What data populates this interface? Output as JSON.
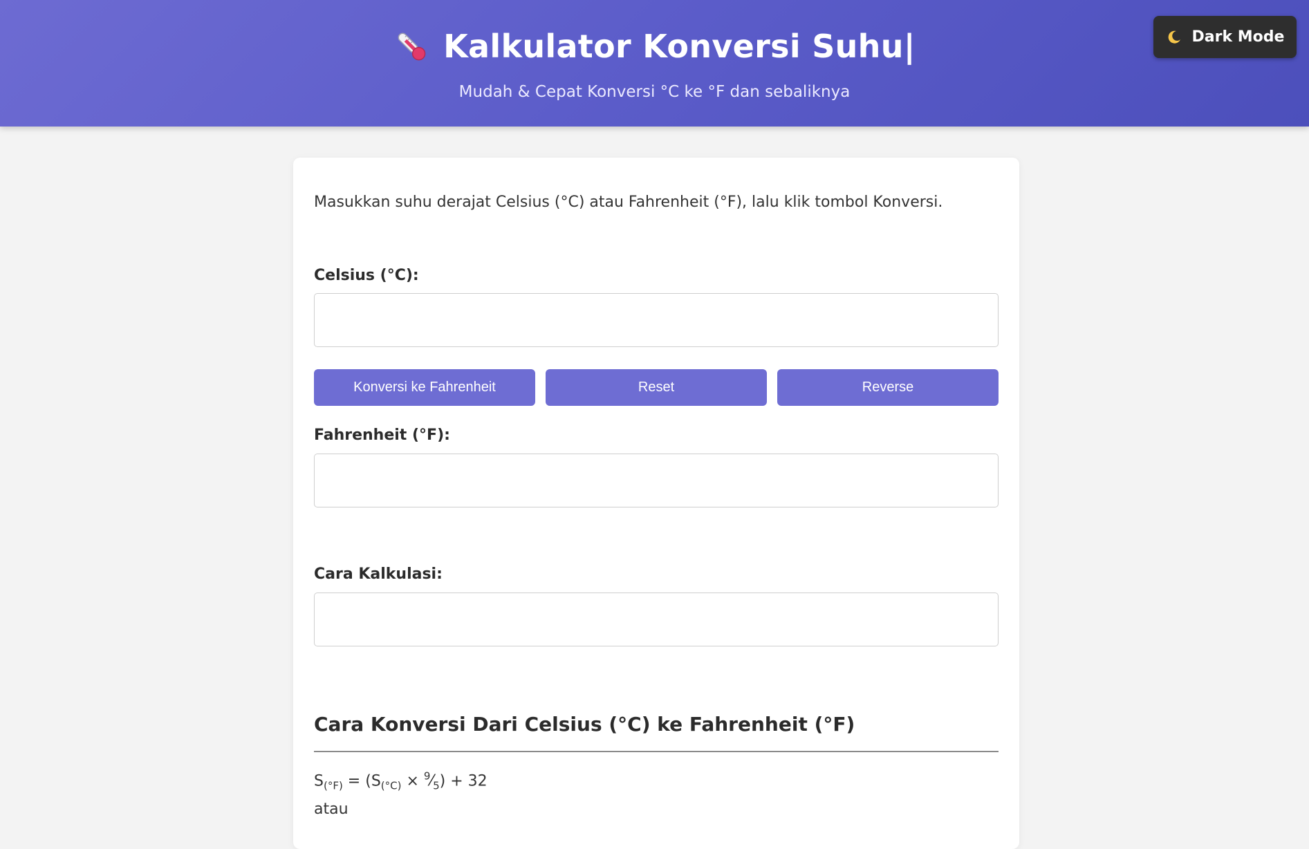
{
  "header": {
    "title": "Kalkulator Konversi Suhu|",
    "subtitle": "Mudah & Cepat Konversi °C ke °F dan sebaliknya",
    "title_icon": "thermometer-icon",
    "dark_mode_label": "Dark Mode",
    "dark_mode_icon": "moon-icon"
  },
  "main": {
    "intro": "Masukkan suhu derajat Celsius (°C) atau Fahrenheit (°F), lalu klik tombol Konversi.",
    "celsius_label": "Celsius (°C):",
    "celsius_value": "",
    "buttons": {
      "convert": "Konversi ke Fahrenheit",
      "reset": "Reset",
      "reverse": "Reverse"
    },
    "fahrenheit_label": "Fahrenheit (°F):",
    "fahrenheit_value": "",
    "calc_label": "Cara Kalkulasi:",
    "calc_value": "",
    "section_title": "Cara Konversi Dari Celsius (°C) ke Fahrenheit (°F)",
    "formula": {
      "s": "S",
      "f_sub": "(°F)",
      "eq": " = (S",
      "c_sub": "(°C)",
      "times": " × ",
      "num": "9",
      "slash": "⁄",
      "den": "5",
      "tail": ") + 32"
    },
    "or_text": "atau"
  },
  "colors": {
    "header_gradient_start": "#6d6bd2",
    "header_gradient_end": "#4c4fbb",
    "button": "#6e6dd3",
    "dark_button": "#2e2e2e",
    "page_bg": "#f3f3f3"
  }
}
